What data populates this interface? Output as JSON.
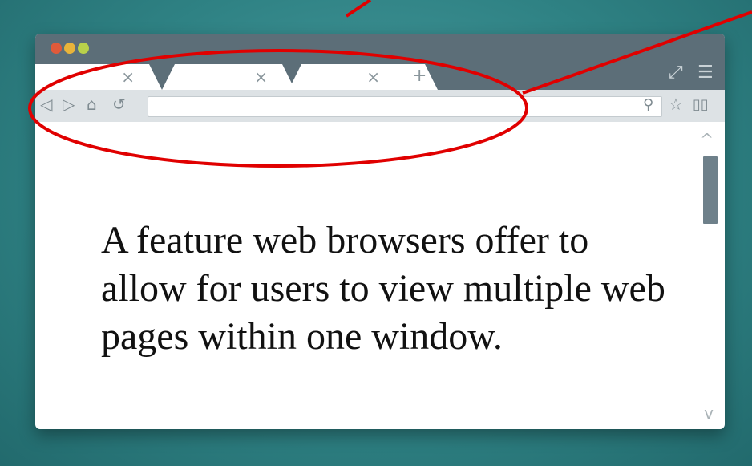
{
  "browser": {
    "tabs": [
      {
        "close_icon": "×"
      },
      {
        "close_icon": "×"
      },
      {
        "close_icon": "×"
      }
    ],
    "new_tab_icon": "+",
    "expand_icon": "⤢",
    "menu_icon": "☰",
    "nav": {
      "back_icon": "◁",
      "forward_icon": "▷",
      "home_icon": "⌂",
      "reload_icon": "↺",
      "search_icon": "⚲",
      "bookmark_icon": "☆",
      "reader_icon": "▯▯"
    },
    "address_value": ""
  },
  "content": {
    "text": "A feature web browsers offer to allow for users to view multiple web pages within one window."
  },
  "scrollbar": {
    "up_icon": "^",
    "down_icon": "v",
    "position": 0.45
  },
  "annotation": {
    "shape": "ellipse",
    "color": "#e00000"
  }
}
